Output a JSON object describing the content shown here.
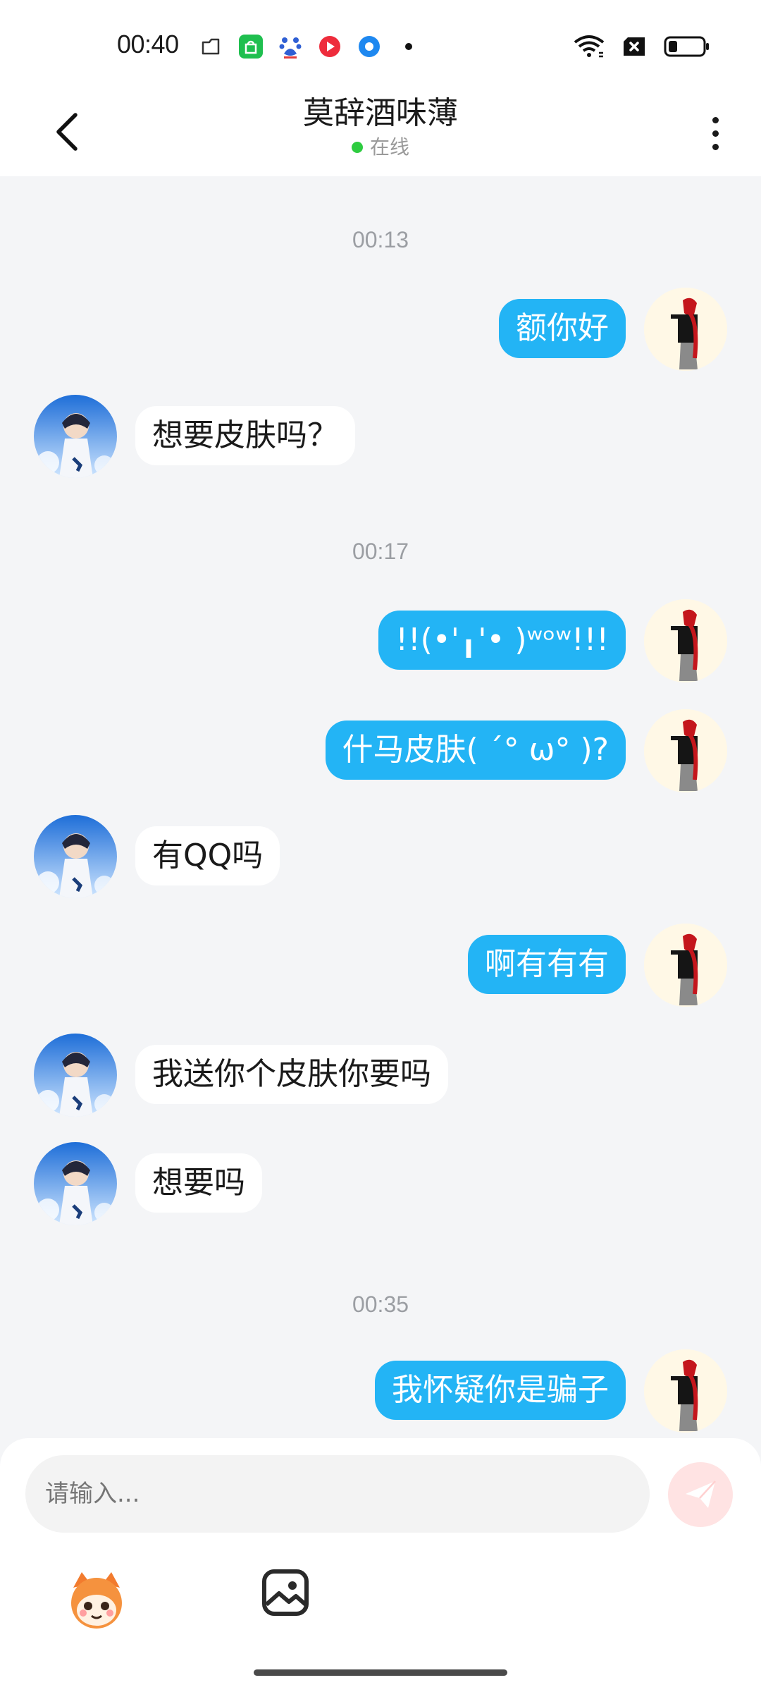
{
  "status_bar": {
    "time": "00:40",
    "icons_left": [
      "folder-icon",
      "shopping-bag-icon",
      "baidu-paw-icon",
      "video-red-icon",
      "blue-circle-app-icon",
      "notification-dot-icon"
    ],
    "icons_right": [
      "wifi-icon",
      "no-sim-icon",
      "battery-icon"
    ]
  },
  "header": {
    "title": "莫辞酒味薄",
    "presence": "在线",
    "presence_color": "#2ecc40"
  },
  "messages": [
    {
      "type": "timestamp",
      "text": "00:13"
    },
    {
      "type": "message",
      "side": "right",
      "text": "额你好"
    },
    {
      "type": "message",
      "side": "left",
      "text": "想要皮肤吗？"
    },
    {
      "type": "timestamp",
      "text": "00:17"
    },
    {
      "type": "message",
      "side": "right",
      "text": "!!(•'╻'• )ʷᵒʷ!!!"
    },
    {
      "type": "message",
      "side": "right",
      "text": "什马皮肤( ˊ° ω° )?"
    },
    {
      "type": "message",
      "side": "left",
      "text": "有QQ吗"
    },
    {
      "type": "message",
      "side": "right",
      "text": "啊有有有"
    },
    {
      "type": "message",
      "side": "left",
      "text": "我送你个皮肤你要吗"
    },
    {
      "type": "message",
      "side": "left",
      "text": "想要吗"
    },
    {
      "type": "timestamp",
      "text": "00:35"
    },
    {
      "type": "message",
      "side": "right",
      "text": "我怀疑你是骗子"
    }
  ],
  "composer": {
    "placeholder": "请输入..."
  },
  "colors": {
    "sent_bubble": "#23b4f5",
    "received_bubble": "#ffffff",
    "chat_background": "#f4f5f7"
  }
}
